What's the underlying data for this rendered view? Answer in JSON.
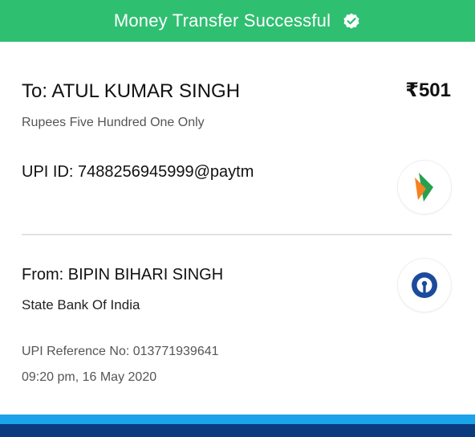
{
  "banner": {
    "title": "Money Transfer Successful",
    "icon": "verified-check-icon",
    "color": "#2fbf71"
  },
  "recipient": {
    "label_name": "To: ATUL KUMAR SINGH",
    "amount": "₹501",
    "amount_words": "Rupees Five Hundred One Only",
    "upi_id": "UPI ID: 7488256945999@paytm",
    "logo_icon": "upi-logo-icon"
  },
  "sender": {
    "label_name": "From: BIPIN BIHARI  SINGH",
    "bank": "State Bank Of India",
    "logo_icon": "sbi-logo-icon"
  },
  "transaction": {
    "reference": "UPI Reference No: 013771939641",
    "timestamp": "09:20 pm, 16 May 2020"
  },
  "colors": {
    "success_green": "#2fbf71",
    "footer_blue": "#0b3a7e",
    "footer_accent": "#1aa3e8",
    "sbi_blue": "#1c4a9c"
  }
}
